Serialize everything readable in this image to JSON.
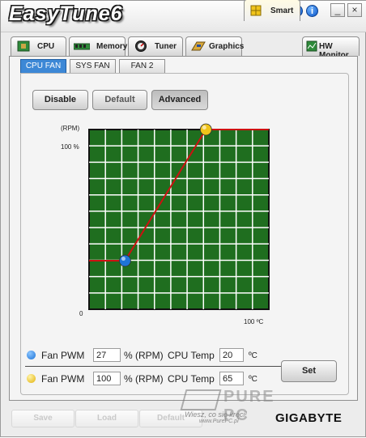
{
  "app": {
    "title": "EasyTune6"
  },
  "title_buttons": [
    {
      "name": "refresh-icon",
      "glyph": "◐"
    },
    {
      "name": "at-icon",
      "glyph": "@"
    },
    {
      "name": "help-icon",
      "glyph": "?"
    },
    {
      "name": "info-icon",
      "glyph": "i"
    }
  ],
  "window_buttons": {
    "minimize": "_",
    "close": "×"
  },
  "main_tabs": [
    {
      "label": "CPU",
      "icon": "cpu-chip-icon"
    },
    {
      "label": "Memory",
      "icon": "memory-stick-icon"
    },
    {
      "label": "Tuner",
      "icon": "tuner-gauge-icon"
    },
    {
      "label": "Graphics",
      "icon": "graphics-card-icon"
    },
    {
      "label": "Smart",
      "icon": "smart-cube-icon",
      "active": true
    },
    {
      "label": "HW Monitor",
      "icon": "hw-monitor-icon"
    }
  ],
  "sub_tabs": [
    {
      "label": "CPU FAN",
      "active": true
    },
    {
      "label": "SYS FAN"
    },
    {
      "label": "FAN 2"
    }
  ],
  "mode_buttons": {
    "disable": "Disable",
    "default": "Default",
    "advanced": "Advanced"
  },
  "chart": {
    "y_unit": "(RPM)",
    "y_top": "100 %",
    "y_bottom": "0",
    "x_right": "100 ºC",
    "grid_color": "#ffffff",
    "bg_color": "#1f6e1f",
    "line_color": "#cc1111"
  },
  "chart_data": {
    "type": "line",
    "xlabel": "ºC",
    "ylabel": "(RPM)",
    "xlim": [
      0,
      100
    ],
    "ylim": [
      0,
      100
    ],
    "series": [
      {
        "values_x": [
          0,
          20,
          65,
          100
        ],
        "values_y": [
          27,
          27,
          100,
          100
        ]
      }
    ],
    "control_points": [
      {
        "x": 20,
        "y": 27,
        "color": "#1e74d8"
      },
      {
        "x": 65,
        "y": 100,
        "color": "#f0c419"
      }
    ]
  },
  "points": [
    {
      "color": "#1e74d8",
      "pwm_label": "Fan PWM",
      "pwm": "27",
      "unit": "% (RPM)",
      "temp_label": "CPU Temp",
      "temp": "20",
      "temp_unit": "ºC"
    },
    {
      "color": "#f0c419",
      "pwm_label": "Fan PWM",
      "pwm": "100",
      "unit": "% (RPM)",
      "temp_label": "CPU Temp",
      "temp": "65",
      "temp_unit": "ºC"
    }
  ],
  "set_button": "Set",
  "footer": {
    "save": "Save",
    "load": "Load",
    "default": "Default",
    "brand": "GIGABYTE"
  },
  "watermark": {
    "brand": "PURE PC",
    "caption": "Wiesz, co się kręci!",
    "url": "www.PurePC.pl"
  }
}
